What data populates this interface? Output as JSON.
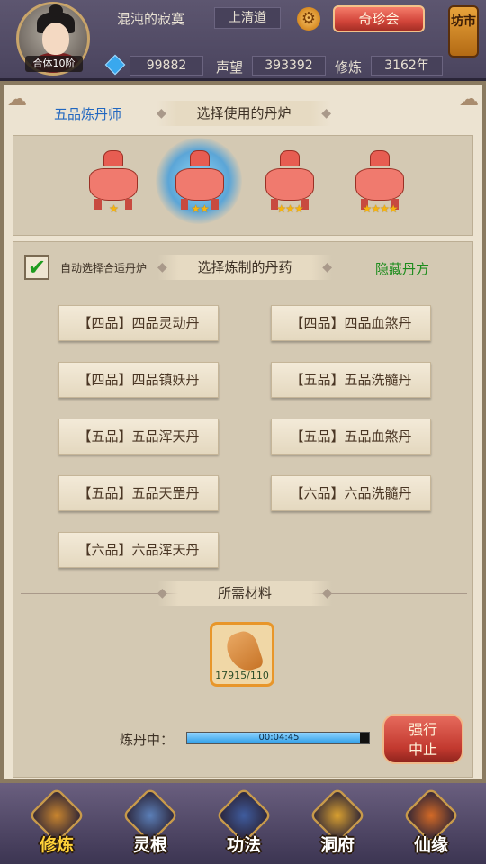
{
  "header": {
    "player_name": "混沌的寂寞",
    "realm": "上清道",
    "avatar_level": "合体10阶",
    "treasure_button": "奇珍会",
    "market_button": "坊市",
    "spirit_stones": "99882",
    "reputation_label": "声望",
    "reputation": "393392",
    "cultivation_label": "修炼",
    "cultivation": "3162年"
  },
  "furnace_section": {
    "rank_title": "五品炼丹师",
    "title": "选择使用的丹炉",
    "furnaces": [
      {
        "stars": 1,
        "selected": false
      },
      {
        "stars": 2,
        "selected": true
      },
      {
        "stars": 3,
        "selected": false
      },
      {
        "stars": 4,
        "selected": false
      }
    ]
  },
  "recipe_section": {
    "auto_select_label": "自动选择合适丹炉",
    "auto_select_checked": true,
    "title": "选择炼制的丹药",
    "hidden_recipes_link": "隐藏丹方",
    "recipes": [
      "【四品】四品灵动丹",
      "【四品】四品血煞丹",
      "【四品】四品镇妖丹",
      "【五品】五品洗髓丹",
      "【五品】五品浑天丹",
      "【五品】五品血煞丹",
      "【五品】五品天罡丹",
      "【六品】六品洗髓丹",
      "【六品】六品浑天丹"
    ]
  },
  "materials": {
    "title": "所需材料",
    "item_icon": "ginseng-root-icon",
    "count": "17915/110"
  },
  "progress": {
    "label": "炼丹中：",
    "time": "00:04:45",
    "fraction": 0.95,
    "stop_button": "强行\n中止"
  },
  "bottom_nav": [
    {
      "label": "修炼",
      "icon": "cultivate-icon",
      "active": true,
      "color": "#c9852e"
    },
    {
      "label": "灵根",
      "icon": "spirit-root-icon",
      "active": false,
      "color": "#5b7fb8"
    },
    {
      "label": "功法",
      "icon": "scripture-icon",
      "active": false,
      "color": "#3f5c9e"
    },
    {
      "label": "洞府",
      "icon": "cave-mansion-icon",
      "active": false,
      "color": "#d9a030"
    },
    {
      "label": "仙缘",
      "icon": "gourd-icon",
      "active": false,
      "color": "#d46a26"
    }
  ]
}
